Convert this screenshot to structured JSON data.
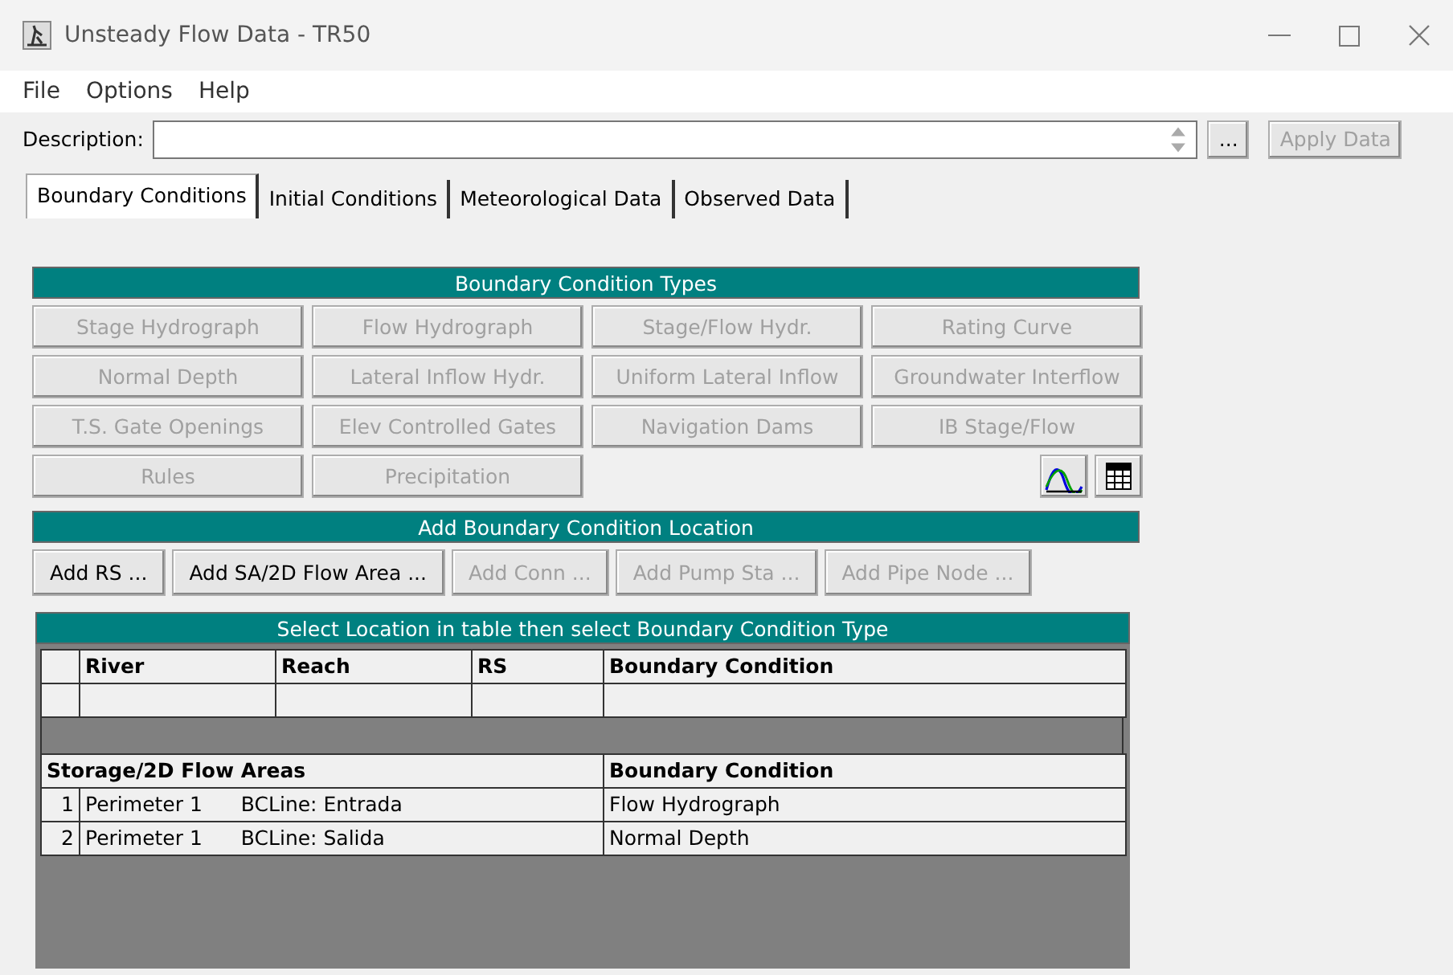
{
  "window": {
    "title": "Unsteady Flow Data - TR50"
  },
  "menu": [
    "File",
    "Options",
    "Help"
  ],
  "description": {
    "label": "Description:",
    "browse": "...",
    "apply": "Apply Data",
    "apply_disabled": true
  },
  "tabs": [
    {
      "label": "Boundary Conditions",
      "selected": true
    },
    {
      "label": "Initial Conditions",
      "selected": false
    },
    {
      "label": "Meteorological Data",
      "selected": false
    },
    {
      "label": "Observed Data",
      "selected": false
    }
  ],
  "bc_types": {
    "title": "Boundary Condition Types",
    "buttons": [
      {
        "label": "Stage Hydrograph",
        "disabled": true
      },
      {
        "label": "Flow Hydrograph",
        "disabled": true
      },
      {
        "label": "Stage/Flow Hydr.",
        "disabled": true
      },
      {
        "label": "Rating Curve",
        "disabled": true
      },
      {
        "label": "Normal Depth",
        "disabled": true
      },
      {
        "label": "Lateral Inflow Hydr.",
        "disabled": true
      },
      {
        "label": "Uniform Lateral Inflow",
        "disabled": true
      },
      {
        "label": "Groundwater Interflow",
        "disabled": true
      },
      {
        "label": "T.S. Gate Openings",
        "disabled": true
      },
      {
        "label": "Elev Controlled Gates",
        "disabled": true
      },
      {
        "label": "Navigation Dams",
        "disabled": true
      },
      {
        "label": "IB Stage/Flow",
        "disabled": true
      },
      {
        "label": "Rules",
        "disabled": true
      },
      {
        "label": "Precipitation",
        "disabled": true
      }
    ]
  },
  "add_location": {
    "title": "Add Boundary Condition Location",
    "buttons": [
      {
        "label": "Add RS ...",
        "disabled": false
      },
      {
        "label": "Add SA/2D Flow Area ...",
        "disabled": false
      },
      {
        "label": "Add Conn ...",
        "disabled": true
      },
      {
        "label": "Add Pump Sta ...",
        "disabled": true
      },
      {
        "label": "Add Pipe Node ...",
        "disabled": true
      }
    ]
  },
  "location_table": {
    "title": "Select Location in table then select Boundary Condition Type",
    "columns": [
      "River",
      "Reach",
      "RS",
      "Boundary Condition"
    ],
    "storage_columns": [
      "Storage/2D Flow Areas",
      "Boundary Condition"
    ],
    "storage_rows": [
      {
        "number": "1",
        "area": "Perimeter 1",
        "bc_line": "BCLine: Entrada",
        "boundary_condition": "Flow Hydrograph"
      },
      {
        "number": "2",
        "area": "Perimeter 1",
        "bc_line": "BCLine: Salida",
        "boundary_condition": "Normal Depth"
      }
    ]
  }
}
